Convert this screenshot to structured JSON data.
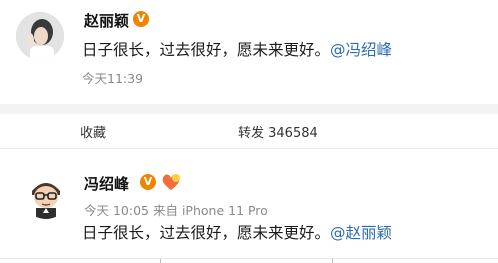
{
  "post1": {
    "author": "赵丽颖",
    "badge_icon": "verified-v-icon",
    "content_text": "日子很长，过去很好，愿未来更好。",
    "mention": "@冯绍峰",
    "time": "今天11:39"
  },
  "actions": {
    "favorite_label": "收藏",
    "repost_label": "转发 346584"
  },
  "post2": {
    "author": "冯绍峰",
    "badge_icon": "verified-v-icon",
    "extra_badge_icon": "fan-badge-icon",
    "meta": "今天 10:05 来自 iPhone 11 Pro",
    "content_text": "日子很长，过去很好，愿未来更好。",
    "mention": "@赵丽颖"
  },
  "colors": {
    "verified_badge": "#f08300",
    "mention_link": "#2a6bb5",
    "meta_text": "#8a8a8a",
    "separator": "#f3f3f3"
  }
}
